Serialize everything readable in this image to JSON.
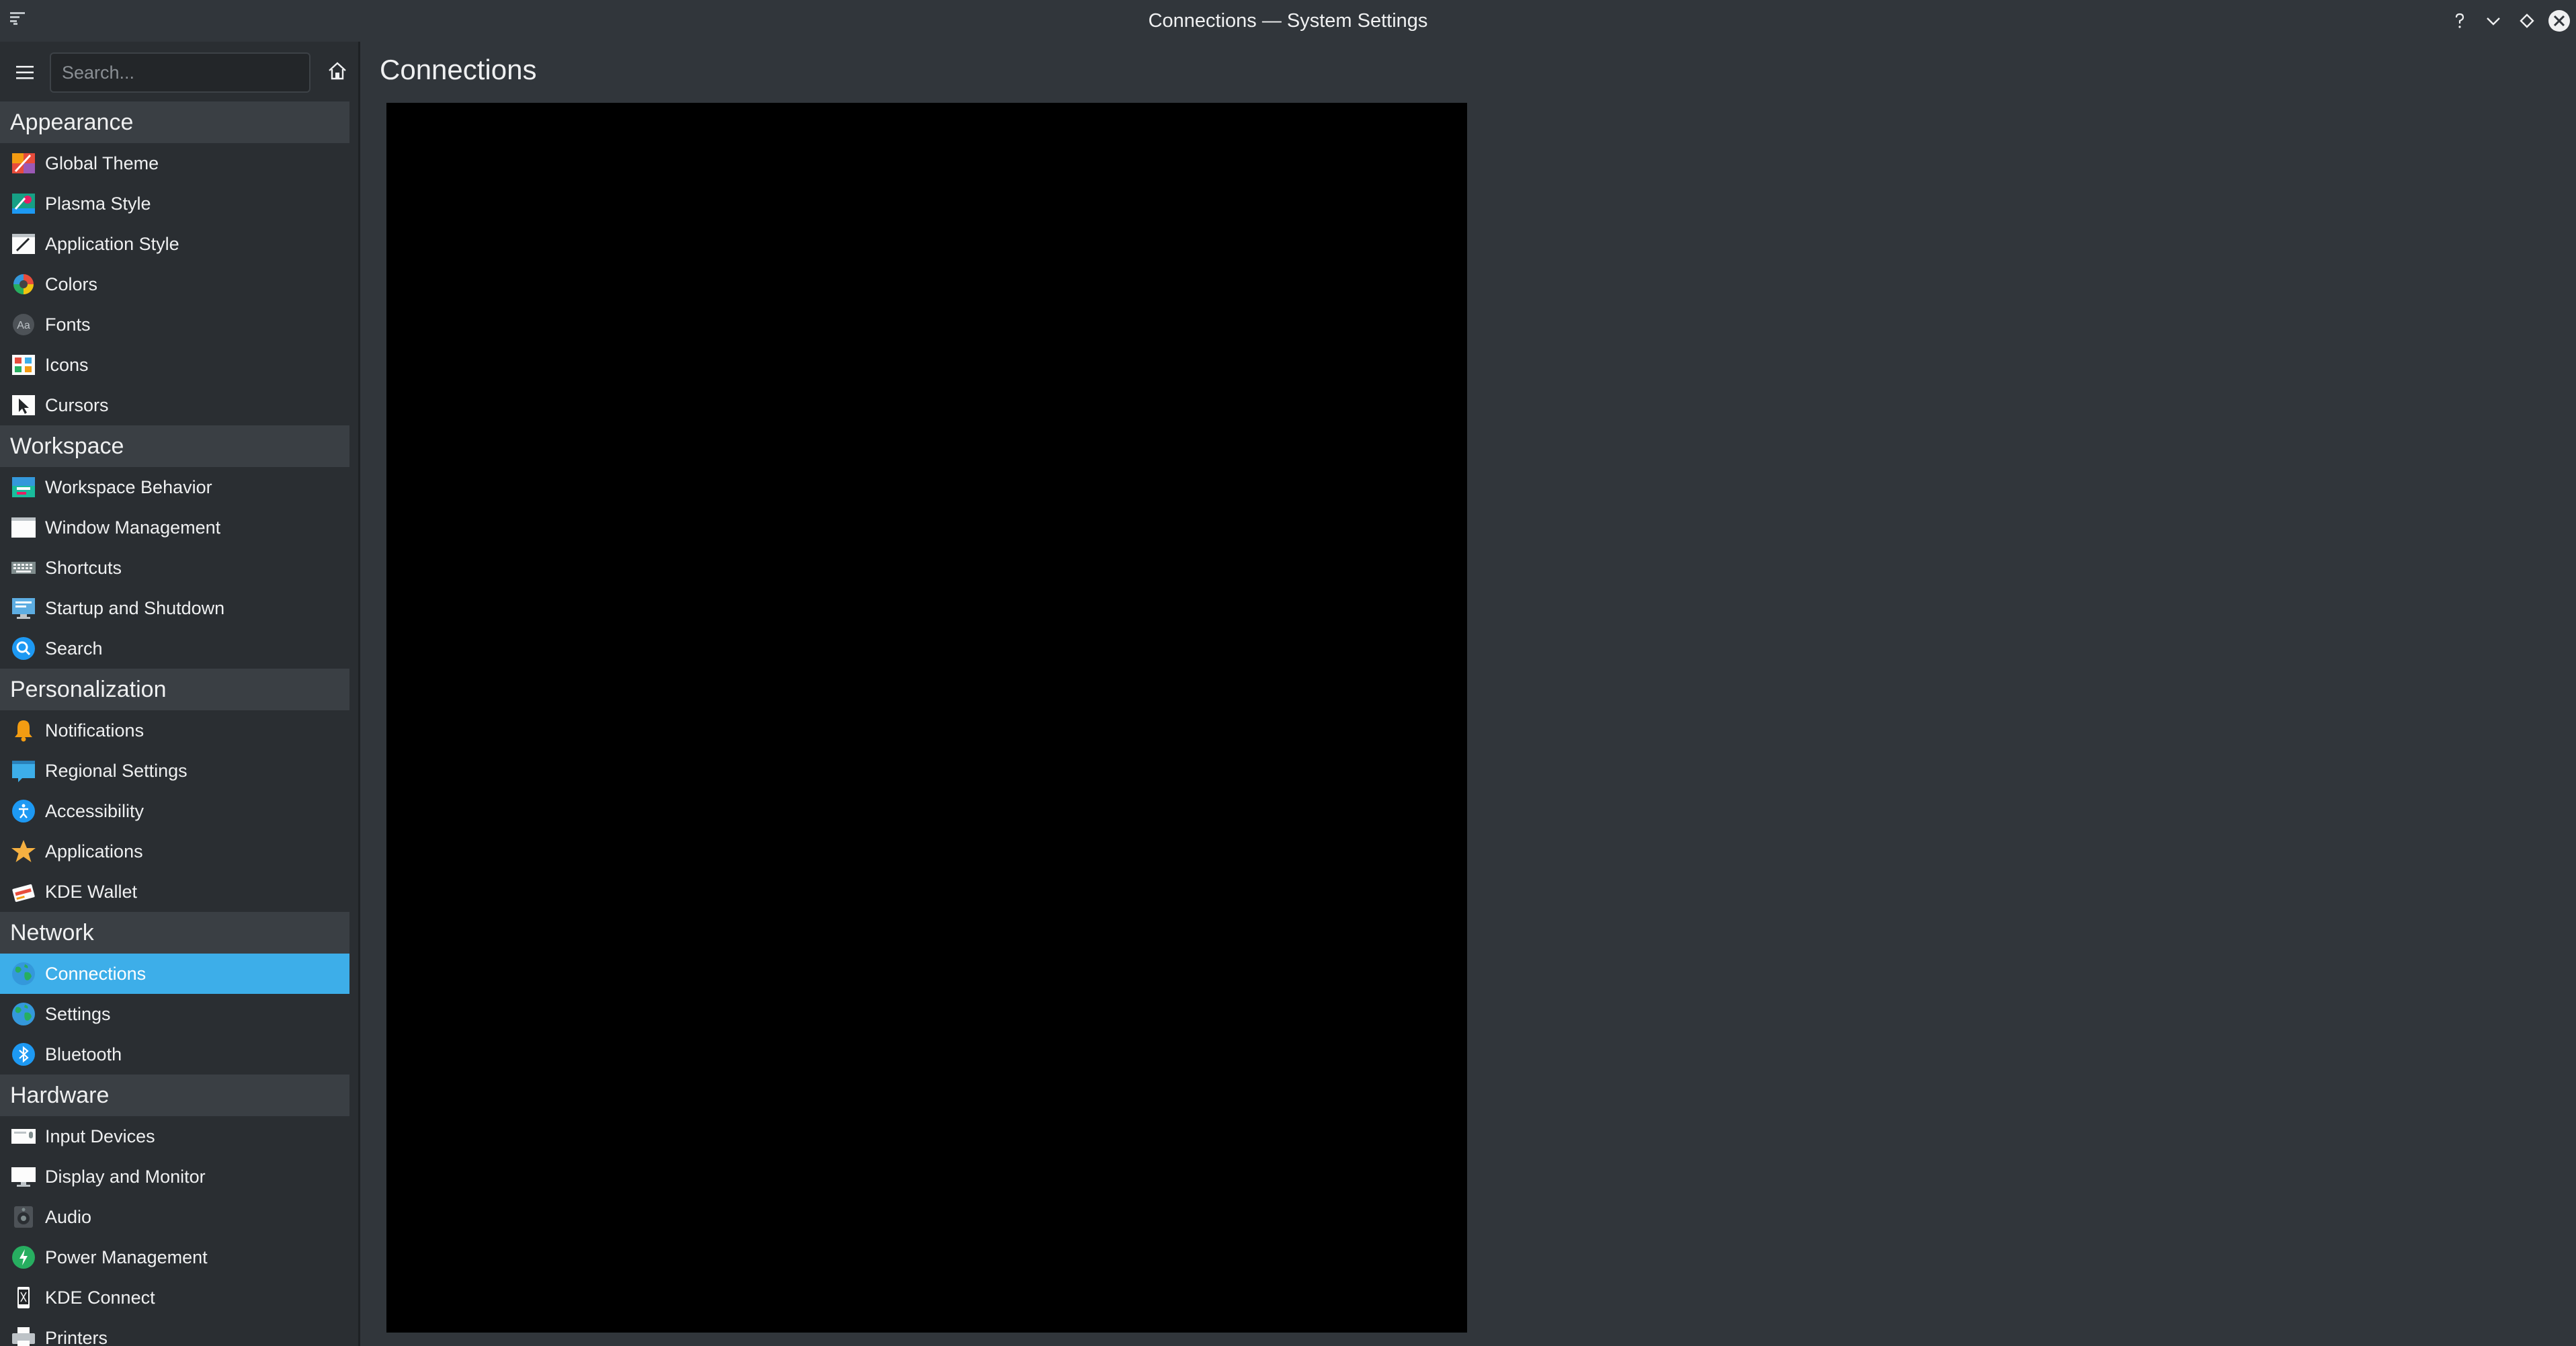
{
  "window": {
    "title": "Connections — System Settings"
  },
  "search": {
    "placeholder": "Search..."
  },
  "page": {
    "title": "Connections"
  },
  "sidebar": {
    "sections": [
      {
        "title": "Appearance",
        "items": [
          {
            "label": "Global Theme",
            "icon": "global-theme-icon"
          },
          {
            "label": "Plasma Style",
            "icon": "plasma-style-icon"
          },
          {
            "label": "Application Style",
            "icon": "application-style-icon"
          },
          {
            "label": "Colors",
            "icon": "colors-icon"
          },
          {
            "label": "Fonts",
            "icon": "fonts-icon",
            "glyph": "Aa"
          },
          {
            "label": "Icons",
            "icon": "icons-icon"
          },
          {
            "label": "Cursors",
            "icon": "cursors-icon"
          }
        ]
      },
      {
        "title": "Workspace",
        "items": [
          {
            "label": "Workspace Behavior",
            "icon": "workspace-behavior-icon"
          },
          {
            "label": "Window Management",
            "icon": "window-management-icon"
          },
          {
            "label": "Shortcuts",
            "icon": "keyboard-icon"
          },
          {
            "label": "Startup and Shutdown",
            "icon": "startup-shutdown-icon"
          },
          {
            "label": "Search",
            "icon": "search-icon"
          }
        ]
      },
      {
        "title": "Personalization",
        "items": [
          {
            "label": "Notifications",
            "icon": "bell-icon"
          },
          {
            "label": "Regional Settings",
            "icon": "regional-settings-icon"
          },
          {
            "label": "Accessibility",
            "icon": "accessibility-icon"
          },
          {
            "label": "Applications",
            "icon": "star-icon"
          },
          {
            "label": "KDE Wallet",
            "icon": "wallet-icon"
          }
        ]
      },
      {
        "title": "Network",
        "items": [
          {
            "label": "Connections",
            "icon": "globe-icon",
            "selected": true
          },
          {
            "label": "Settings",
            "icon": "globe-icon"
          },
          {
            "label": "Bluetooth",
            "icon": "bluetooth-icon"
          }
        ]
      },
      {
        "title": "Hardware",
        "items": [
          {
            "label": "Input Devices",
            "icon": "input-devices-icon"
          },
          {
            "label": "Display and Monitor",
            "icon": "monitor-icon"
          },
          {
            "label": "Audio",
            "icon": "speaker-icon"
          },
          {
            "label": "Power Management",
            "icon": "power-icon"
          },
          {
            "label": "KDE Connect",
            "icon": "kde-connect-icon"
          },
          {
            "label": "Printers",
            "icon": "printer-icon"
          }
        ]
      }
    ]
  },
  "colors": {
    "accent": "#3daee9",
    "background": "#31363b",
    "sidebar": "#2a2e32",
    "section_header": "#3a3f44",
    "content": "#000000"
  }
}
